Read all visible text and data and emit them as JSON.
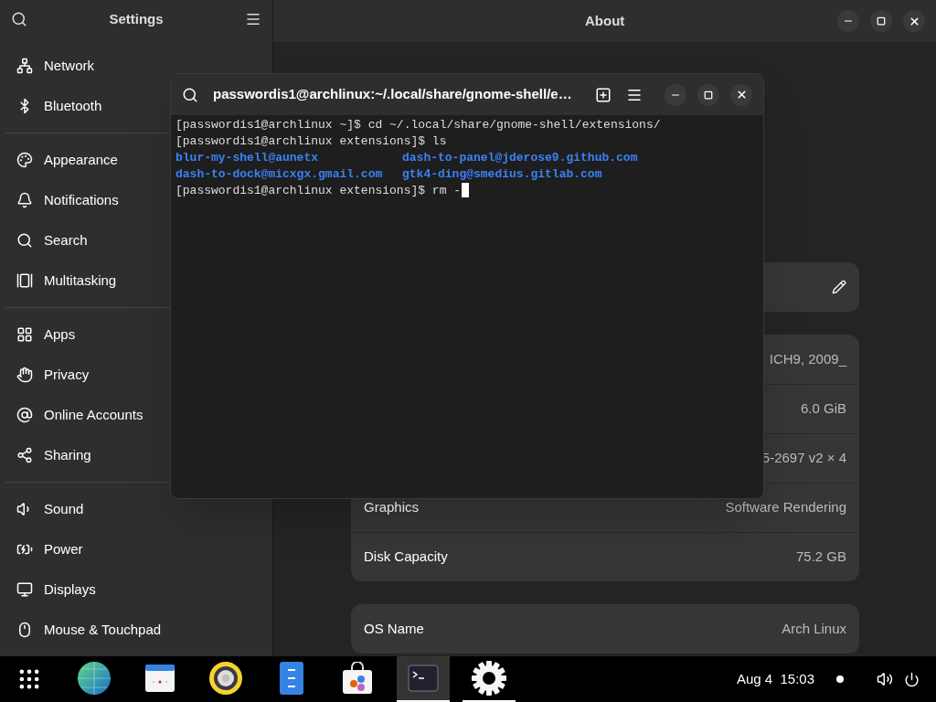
{
  "sidebar": {
    "title": "Settings",
    "groups": [
      {
        "items": [
          {
            "label": "Network"
          },
          {
            "label": "Bluetooth"
          }
        ]
      },
      {
        "items": [
          {
            "label": "Appearance"
          },
          {
            "label": "Notifications"
          },
          {
            "label": "Search"
          },
          {
            "label": "Multitasking"
          }
        ]
      },
      {
        "items": [
          {
            "label": "Apps"
          },
          {
            "label": "Privacy"
          },
          {
            "label": "Online Accounts"
          },
          {
            "label": "Sharing"
          }
        ]
      },
      {
        "items": [
          {
            "label": "Sound"
          },
          {
            "label": "Power"
          },
          {
            "label": "Displays"
          },
          {
            "label": "Mouse & Touchpad"
          }
        ]
      }
    ]
  },
  "main": {
    "title": "About",
    "cards": [
      {
        "kind": "editable"
      },
      {
        "kind": "info",
        "rows": [
          {
            "value": "ICH9, 2009_"
          },
          {
            "value": "6.0 GiB"
          },
          {
            "value": "5-2697 v2 × 4"
          },
          {
            "label": "Graphics",
            "value": "Software Rendering"
          },
          {
            "label": "Disk Capacity",
            "value": "75.2 GB"
          }
        ]
      },
      {
        "kind": "info",
        "rows": [
          {
            "label": "OS Name",
            "value": "Arch Linux"
          }
        ]
      }
    ]
  },
  "terminal": {
    "title": "passwordis1@archlinux:~/.local/share/gnome-shell/e…",
    "lines": [
      {
        "kind": "text",
        "text": "[passwordis1@archlinux ~]$ cd ~/.local/share/gnome-shell/extensions/"
      },
      {
        "kind": "text",
        "text": "[passwordis1@archlinux extensions]$ ls"
      },
      {
        "kind": "listing",
        "entries": [
          "blur-my-shell@aunetx",
          "dash-to-panel@jderose9.github.com"
        ]
      },
      {
        "kind": "listing",
        "entries": [
          "dash-to-dock@micxgx.gmail.com",
          "gtk4-ding@smedius.gitlab.com"
        ]
      },
      {
        "kind": "prompt",
        "text": "[passwordis1@archlinux extensions]$ rm -"
      }
    ]
  },
  "taskbar": {
    "apps": [
      {
        "running": false,
        "focused": false
      },
      {
        "running": false,
        "focused": false
      },
      {
        "running": false,
        "focused": false
      },
      {
        "running": false,
        "focused": false
      },
      {
        "running": false,
        "focused": false
      },
      {
        "running": true,
        "focused": true
      },
      {
        "running": true,
        "focused": false
      }
    ],
    "clock": "Aug 4  15:03"
  }
}
